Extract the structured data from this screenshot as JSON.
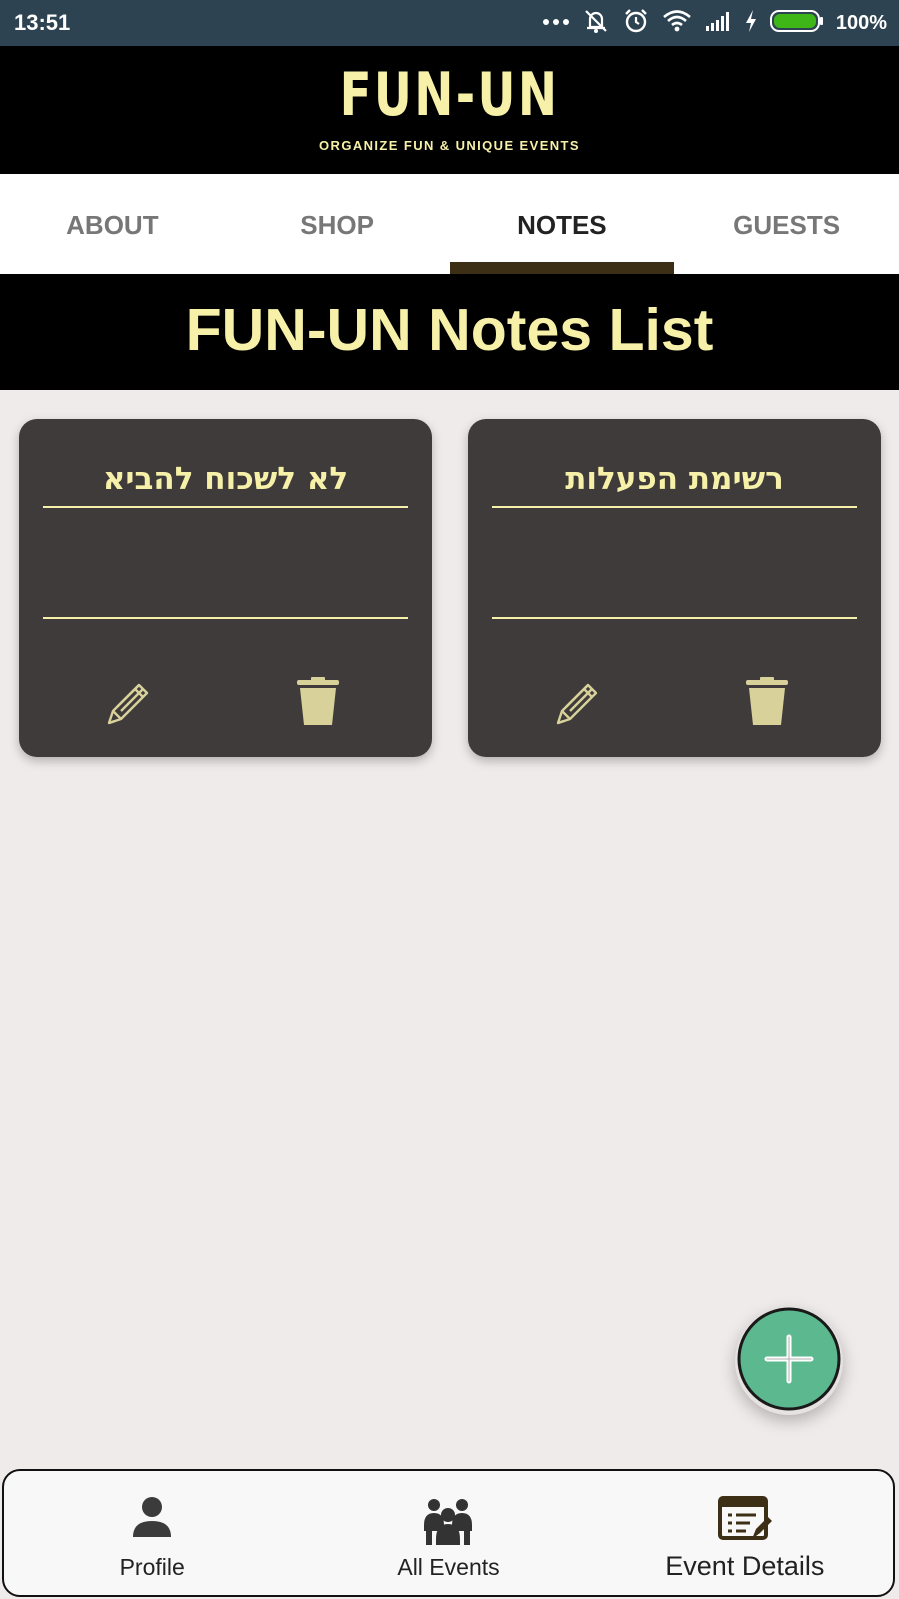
{
  "status_bar": {
    "time": "13:51",
    "battery_percent": "100%",
    "icons": [
      "more-dots-icon",
      "notifications-off-icon",
      "alarm-icon",
      "wifi-icon",
      "cellular-signal-icon",
      "charging-bolt-icon",
      "battery-icon"
    ],
    "battery_color": "#3fb618"
  },
  "app_bar": {
    "logo_title": "FUN-UN",
    "logo_tagline": "ORGANIZE FUN & UNIQUE EVENTS"
  },
  "tabs": [
    {
      "label": "ABOUT",
      "active": false
    },
    {
      "label": "SHOP",
      "active": false
    },
    {
      "label": "NOTES",
      "active": true
    },
    {
      "label": "GUESTS",
      "active": false
    }
  ],
  "section": {
    "title": "FUN-UN Notes List"
  },
  "notes": [
    {
      "title": "לא לשכוח להביא",
      "actions": [
        "pencil-icon",
        "trash-icon"
      ]
    },
    {
      "title": "רשימת הפעלות",
      "actions": [
        "pencil-icon",
        "trash-icon"
      ]
    }
  ],
  "fab": {
    "icon": "plus-icon",
    "color": "#5bb88f"
  },
  "bottom_nav": [
    {
      "label": "Profile",
      "icon": "person-icon"
    },
    {
      "label": "All Events",
      "icon": "group-icon"
    },
    {
      "label": "Event Details",
      "icon": "event-details-icon"
    }
  ],
  "colors": {
    "accent_yellow": "#f6f0a8",
    "card_bg": "#3e3b3a",
    "tab_indicator": "#3c2f16",
    "page_bg": "#efebea"
  }
}
